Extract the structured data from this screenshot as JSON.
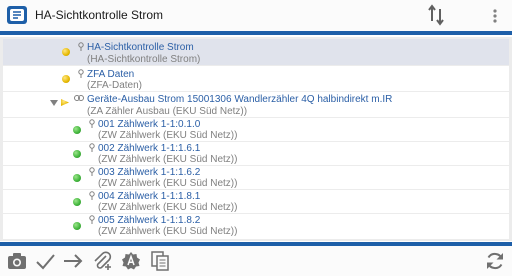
{
  "header": {
    "title": "HA-Sichtkontrolle Strom",
    "app_icon": "app-logo-icon",
    "sort_icon": "sort-arrows-icon",
    "menu_icon": "overflow-menu-icon"
  },
  "colors": {
    "accent": "#1e5fa8",
    "title_text": "#2b5fa6",
    "sub_text": "#808080",
    "selected_row": "#e0e3ec",
    "status_yellow": "#e6b800",
    "status_green": "#3fb43a"
  },
  "tree": {
    "items": [
      {
        "title": "HA-Sichtkontrolle Strom",
        "subtitle": "(HA-Sichtkontrolle Strom)",
        "status": "yellow",
        "selected": true
      },
      {
        "title": "ZFA Daten",
        "subtitle": "(ZFA-Daten)",
        "status": "yellow"
      },
      {
        "title": "Geräte-Ausbau Strom 15001306 Wandlerzähler 4Q halbindirekt m.IR",
        "subtitle": "(ZA Zähler Ausbau (EKU Süd Netz))",
        "status": "yellow",
        "expanded": true
      },
      {
        "title": "001 Zählwerk 1-1:0.1.0",
        "subtitle": "(ZW Zählwerk (EKU Süd Netz))",
        "status": "green"
      },
      {
        "title": "002 Zählwerk 1-1:1.6.1",
        "subtitle": "(ZW Zählwerk (EKU Süd Netz))",
        "status": "green"
      },
      {
        "title": "003 Zählwerk 1-1:1.6.2",
        "subtitle": "(ZW Zählwerk (EKU Süd Netz))",
        "status": "green"
      },
      {
        "title": "004 Zählwerk 1-1:1.8.1",
        "subtitle": "(ZW Zählwerk (EKU Süd Netz))",
        "status": "green"
      },
      {
        "title": "005 Zählwerk 1-1:1.8.2",
        "subtitle": "(ZW Zählwerk (EKU Süd Netz))",
        "status": "green"
      }
    ]
  },
  "toolbar": {
    "buttons": [
      "camera-icon",
      "checkmark-icon",
      "arrow-right-icon",
      "attachment-icon",
      "auto-badge-icon",
      "copy-document-icon",
      "sync-icon"
    ]
  }
}
